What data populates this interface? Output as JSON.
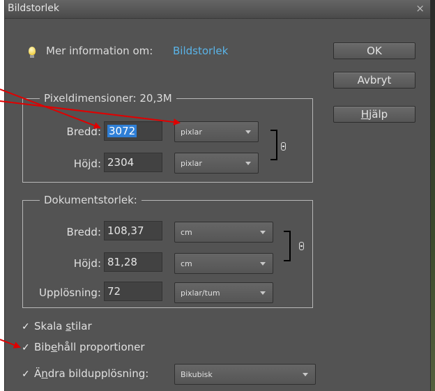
{
  "window": {
    "title": "Bildstorlek",
    "close_glyph": "×"
  },
  "info": {
    "text": "Mer information om:",
    "link": "Bildstorlek",
    "icon": "lightbulb-icon"
  },
  "buttons": {
    "ok": "OK",
    "cancel": "Avbryt",
    "help_underlined": "H",
    "help_rest": "jälp"
  },
  "pixel_dimensions": {
    "title": "Pixeldimensioner: 20,3M",
    "width_label": "Bredd:",
    "width_value": "3072",
    "width_unit": "pixlar",
    "height_label": "Höjd:",
    "height_value": "2304",
    "height_unit": "pixlar"
  },
  "document_size": {
    "title": "Dokumentstorlek:",
    "width_label": "Bredd:",
    "width_value": "108,37",
    "width_unit": "cm",
    "height_label": "Höjd:",
    "height_value": "81,28",
    "height_unit": "cm",
    "resolution_label": "Upplösning:",
    "resolution_value": "72",
    "resolution_unit": "pixlar/tum"
  },
  "options": {
    "scale_styles": {
      "pre": "Skala ",
      "ul": "s",
      "post": "tilar",
      "checked": true
    },
    "constrain": {
      "pre": "Bib",
      "ul": "e",
      "post": "håll proportioner",
      "checked": true
    },
    "resample": {
      "pre": "Ä",
      "ul": "n",
      "post": "dra bildupplösning:",
      "checked": true
    },
    "resample_method": "Bikubisk"
  },
  "colors": {
    "annotation_arrow": "#e00000",
    "link": "#5ab4e8",
    "selection": "#2f7fd6"
  }
}
